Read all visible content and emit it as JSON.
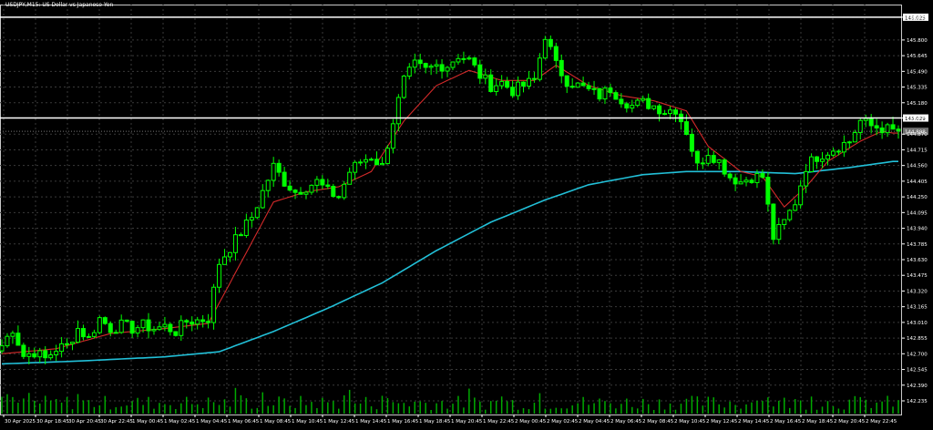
{
  "header": {
    "symbol_label": "USDJPY,M15: US Dollar vs Japanese Yen"
  },
  "colors": {
    "background": "#000000",
    "grid": "#3a3a3a",
    "candle": "#00ff00",
    "volume": "#00aa00",
    "ma_fast": "#d42a2a",
    "ma_slow": "#22c0d8",
    "axis_text": "#ffffff",
    "hline": "#ffffff"
  },
  "chart_data": {
    "type": "candlestick",
    "symbol": "USDJPY",
    "timeframe": "M15",
    "ylim": [
      142.1,
      146.15
    ],
    "grid": true,
    "y_ticks": [
      "146.025",
      "145.800",
      "145.645",
      "145.490",
      "145.335",
      "145.180",
      "145.029",
      "144.870",
      "144.715",
      "144.560",
      "144.405",
      "144.250",
      "144.095",
      "143.940",
      "143.785",
      "143.630",
      "143.475",
      "143.320",
      "143.165",
      "143.010",
      "142.855",
      "142.700",
      "142.545",
      "142.390",
      "142.235"
    ],
    "x_ticks": [
      "30 Apr 2025",
      "30 Apr 18:45",
      "30 Apr 20:45",
      "30 Apr 22:45",
      "1 May 00:45",
      "1 May 02:45",
      "1 May 04:45",
      "1 May 06:45",
      "1 May 08:45",
      "1 May 10:45",
      "1 May 12:45",
      "1 May 14:45",
      "1 May 16:45",
      "1 May 18:45",
      "1 May 20:45",
      "1 May 22:45",
      "2 May 00:45",
      "2 May 02:45",
      "2 May 04:45",
      "2 May 06:45",
      "2 May 08:45",
      "2 May 10:45",
      "2 May 12:45",
      "2 May 14:45",
      "2 May 16:45",
      "2 May 18:45",
      "2 May 20:45",
      "2 May 22:45"
    ],
    "hlines": [
      {
        "label": "146.025",
        "value": 146.025
      },
      {
        "label": "145.029",
        "value": 145.029
      }
    ],
    "current_price_label": "144.898",
    "current_price": 144.898,
    "close_trend": [
      [
        0,
        142.78
      ],
      [
        2,
        142.95
      ],
      [
        4,
        142.68
      ],
      [
        6,
        142.72
      ],
      [
        8,
        142.65
      ],
      [
        10,
        142.75
      ],
      [
        12,
        142.78
      ],
      [
        14,
        142.95
      ],
      [
        16,
        142.85
      ],
      [
        18,
        143.05
      ],
      [
        20,
        142.95
      ],
      [
        22,
        142.98
      ],
      [
        24,
        142.95
      ],
      [
        26,
        142.98
      ],
      [
        28,
        142.95
      ],
      [
        30,
        142.97
      ],
      [
        32,
        142.92
      ],
      [
        34,
        143.02
      ],
      [
        36,
        143.03
      ],
      [
        38,
        143.05
      ],
      [
        40,
        143.6
      ],
      [
        42,
        143.75
      ],
      [
        44,
        143.9
      ],
      [
        46,
        144.05
      ],
      [
        48,
        144.3
      ],
      [
        50,
        144.55
      ],
      [
        52,
        144.4
      ],
      [
        54,
        144.3
      ],
      [
        56,
        144.35
      ],
      [
        58,
        144.4
      ],
      [
        60,
        144.3
      ],
      [
        62,
        144.25
      ],
      [
        64,
        144.5
      ],
      [
        66,
        144.6
      ],
      [
        68,
        144.65
      ],
      [
        70,
        144.55
      ],
      [
        72,
        145.0
      ],
      [
        74,
        145.4
      ],
      [
        76,
        145.55
      ],
      [
        78,
        145.5
      ],
      [
        80,
        145.55
      ],
      [
        82,
        145.55
      ],
      [
        84,
        145.65
      ],
      [
        86,
        145.6
      ],
      [
        88,
        145.45
      ],
      [
        90,
        145.35
      ],
      [
        92,
        145.38
      ],
      [
        94,
        145.3
      ],
      [
        96,
        145.35
      ],
      [
        98,
        145.4
      ],
      [
        100,
        145.85
      ],
      [
        102,
        145.55
      ],
      [
        104,
        145.4
      ],
      [
        106,
        145.35
      ],
      [
        108,
        145.3
      ],
      [
        110,
        145.25
      ],
      [
        112,
        145.32
      ],
      [
        114,
        145.22
      ],
      [
        116,
        145.15
      ],
      [
        118,
        145.18
      ],
      [
        120,
        145.15
      ],
      [
        122,
        145.1
      ],
      [
        124,
        145.12
      ],
      [
        126,
        144.9
      ],
      [
        128,
        144.55
      ],
      [
        130,
        144.7
      ],
      [
        132,
        144.6
      ],
      [
        134,
        144.45
      ],
      [
        136,
        144.4
      ],
      [
        138,
        144.45
      ],
      [
        140,
        144.45
      ],
      [
        142,
        143.85
      ],
      [
        144,
        144.0
      ],
      [
        146,
        144.2
      ],
      [
        148,
        144.55
      ],
      [
        150,
        144.65
      ],
      [
        152,
        144.7
      ],
      [
        154,
        144.75
      ],
      [
        156,
        144.8
      ],
      [
        158,
        145.0
      ],
      [
        160,
        144.95
      ],
      [
        162,
        144.93
      ],
      [
        164,
        144.9
      ]
    ],
    "ma_fast_trend": [
      [
        0,
        142.7
      ],
      [
        10,
        142.75
      ],
      [
        20,
        142.9
      ],
      [
        30,
        142.95
      ],
      [
        38,
        143.0
      ],
      [
        44,
        143.6
      ],
      [
        50,
        144.2
      ],
      [
        56,
        144.3
      ],
      [
        62,
        144.35
      ],
      [
        68,
        144.5
      ],
      [
        74,
        145.0
      ],
      [
        80,
        145.35
      ],
      [
        86,
        145.5
      ],
      [
        92,
        145.4
      ],
      [
        98,
        145.4
      ],
      [
        102,
        145.55
      ],
      [
        108,
        145.35
      ],
      [
        114,
        145.25
      ],
      [
        120,
        145.2
      ],
      [
        126,
        145.1
      ],
      [
        130,
        144.75
      ],
      [
        136,
        144.5
      ],
      [
        140,
        144.45
      ],
      [
        144,
        144.15
      ],
      [
        148,
        144.35
      ],
      [
        152,
        144.6
      ],
      [
        158,
        144.8
      ],
      [
        162,
        144.9
      ],
      [
        164,
        144.88
      ]
    ],
    "ma_slow_trend": [
      [
        0,
        142.6
      ],
      [
        15,
        142.63
      ],
      [
        30,
        142.67
      ],
      [
        40,
        142.72
      ],
      [
        50,
        142.92
      ],
      [
        60,
        143.15
      ],
      [
        70,
        143.4
      ],
      [
        80,
        143.72
      ],
      [
        90,
        144.0
      ],
      [
        100,
        144.22
      ],
      [
        108,
        144.37
      ],
      [
        118,
        144.47
      ],
      [
        126,
        144.5
      ],
      [
        136,
        144.5
      ],
      [
        146,
        144.48
      ],
      [
        156,
        144.54
      ],
      [
        164,
        144.6
      ]
    ]
  }
}
